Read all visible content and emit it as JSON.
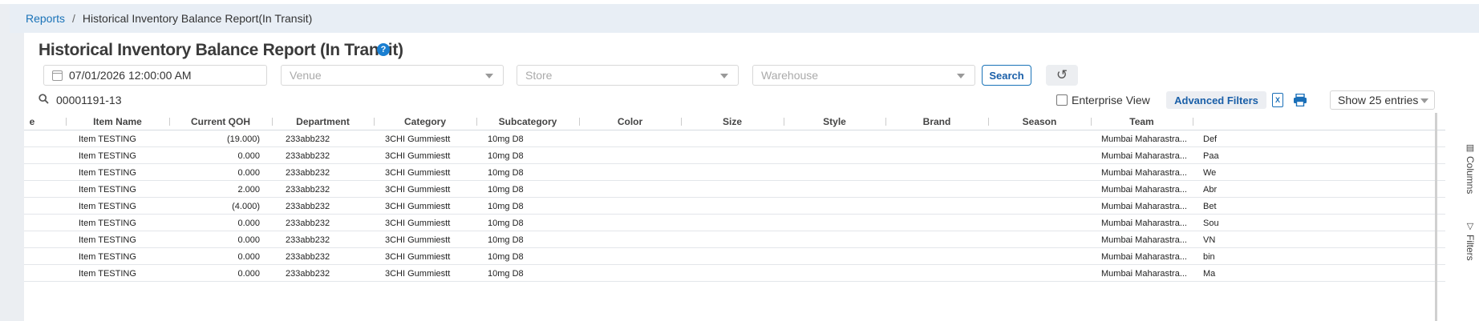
{
  "breadcrumb": {
    "root": "Reports",
    "separator": "/",
    "current": "Historical Inventory Balance Report(In Transit)"
  },
  "page": {
    "title": "Historical Inventory Balance Report (In Transit)",
    "help": "?"
  },
  "filters": {
    "date": "07/01/2026 12:00:00 AM",
    "venue_placeholder": "Venue",
    "store_placeholder": "Store",
    "warehouse_placeholder": "Warehouse",
    "search_label": "Search",
    "reset_icon": "↺"
  },
  "toolbar": {
    "search_value": "00001191-13",
    "enterprise_label": "Enterprise View",
    "advanced_filters_label": "Advanced Filters",
    "excel_icon": "X",
    "entries_label": "Show 25 entries"
  },
  "table": {
    "columns": [
      {
        "label": "e"
      },
      {
        "label": "Item Name"
      },
      {
        "label": "Current QOH"
      },
      {
        "label": "Department"
      },
      {
        "label": "Category"
      },
      {
        "label": "Subcategory"
      },
      {
        "label": "Color"
      },
      {
        "label": "Size"
      },
      {
        "label": "Style"
      },
      {
        "label": "Brand"
      },
      {
        "label": "Season"
      },
      {
        "label": "Team"
      }
    ],
    "rows": [
      {
        "item": "Item TESTING",
        "qoh": "(19.000)",
        "dept": "233abb232",
        "cat": "3CHI Gummiestt",
        "sub": "10mg D8",
        "team": "Mumbai Maharastra...",
        "extra": "Def"
      },
      {
        "item": "Item TESTING",
        "qoh": "0.000",
        "dept": "233abb232",
        "cat": "3CHI Gummiestt",
        "sub": "10mg D8",
        "team": "Mumbai Maharastra...",
        "extra": "Paa"
      },
      {
        "item": "Item TESTING",
        "qoh": "0.000",
        "dept": "233abb232",
        "cat": "3CHI Gummiestt",
        "sub": "10mg D8",
        "team": "Mumbai Maharastra...",
        "extra": "We"
      },
      {
        "item": "Item TESTING",
        "qoh": "2.000",
        "dept": "233abb232",
        "cat": "3CHI Gummiestt",
        "sub": "10mg D8",
        "team": "Mumbai Maharastra...",
        "extra": "Abr"
      },
      {
        "item": "Item TESTING",
        "qoh": "(4.000)",
        "dept": "233abb232",
        "cat": "3CHI Gummiestt",
        "sub": "10mg D8",
        "team": "Mumbai Maharastra...",
        "extra": "Bet"
      },
      {
        "item": "Item TESTING",
        "qoh": "0.000",
        "dept": "233abb232",
        "cat": "3CHI Gummiestt",
        "sub": "10mg D8",
        "team": "Mumbai Maharastra...",
        "extra": "Sou"
      },
      {
        "item": "Item TESTING",
        "qoh": "0.000",
        "dept": "233abb232",
        "cat": "3CHI Gummiestt",
        "sub": "10mg D8",
        "team": "Mumbai Maharastra...",
        "extra": "VN"
      },
      {
        "item": "Item TESTING",
        "qoh": "0.000",
        "dept": "233abb232",
        "cat": "3CHI Gummiestt",
        "sub": "10mg D8",
        "team": "Mumbai Maharastra...",
        "extra": "bin"
      },
      {
        "item": "Item TESTING",
        "qoh": "0.000",
        "dept": "233abb232",
        "cat": "3CHI Gummiestt",
        "sub": "10mg D8",
        "team": "Mumbai Maharastra...",
        "extra": "Ma"
      }
    ]
  },
  "side_panel": {
    "columns_label": "Columns",
    "filters_label": "Filters"
  }
}
